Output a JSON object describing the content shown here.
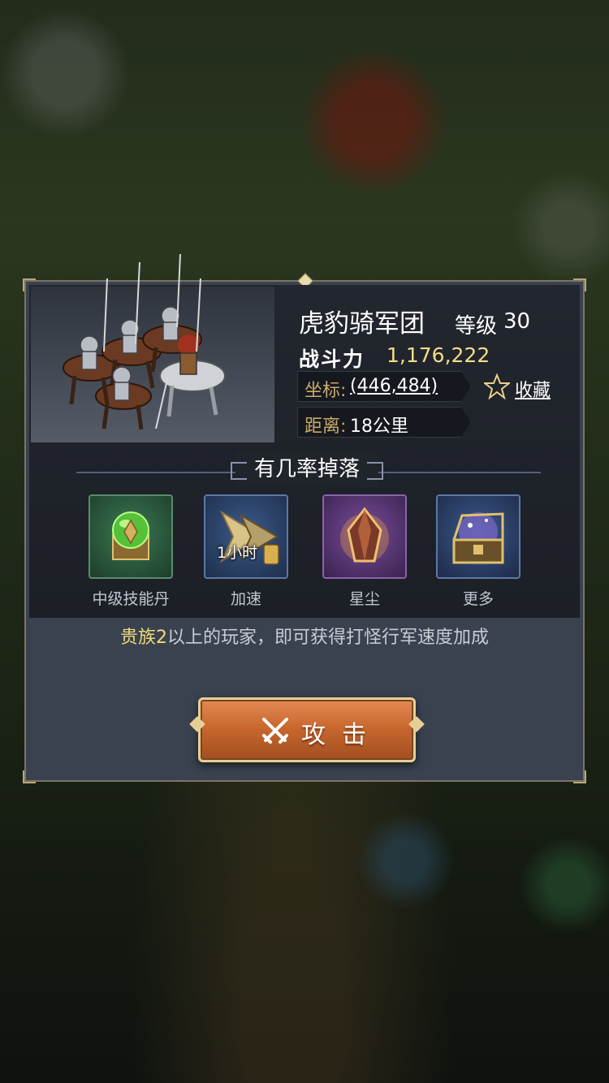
{
  "monster": {
    "name": "虎豹骑军团",
    "level_label": "等级",
    "level": "30",
    "power_label": "战斗力",
    "power": "1,176,222",
    "coord_label": "坐标:",
    "coords": "(446,484)",
    "distance_label": "距离:",
    "distance": "18公里",
    "bookmark_label": "收藏"
  },
  "drops": {
    "title": "有几率掉落",
    "items": [
      {
        "label": "中级技能丹",
        "icon": "green-elixir-icon"
      },
      {
        "label": "加速",
        "icon": "speedup-icon",
        "overlay": "1小时"
      },
      {
        "label": "星尘",
        "icon": "stardust-crystal-icon"
      },
      {
        "label": "更多",
        "icon": "treasure-chest-icon"
      }
    ]
  },
  "tip": {
    "highlight": "贵族2",
    "text": "以上的玩家，即可获得打怪行军速度加成"
  },
  "attack_button": {
    "label": "攻击"
  },
  "colors": {
    "gold_text": "#f3dd86",
    "label_gold": "#c9aa6a",
    "button_orange": "#c9682f",
    "panel_bg": "#3a4250"
  }
}
